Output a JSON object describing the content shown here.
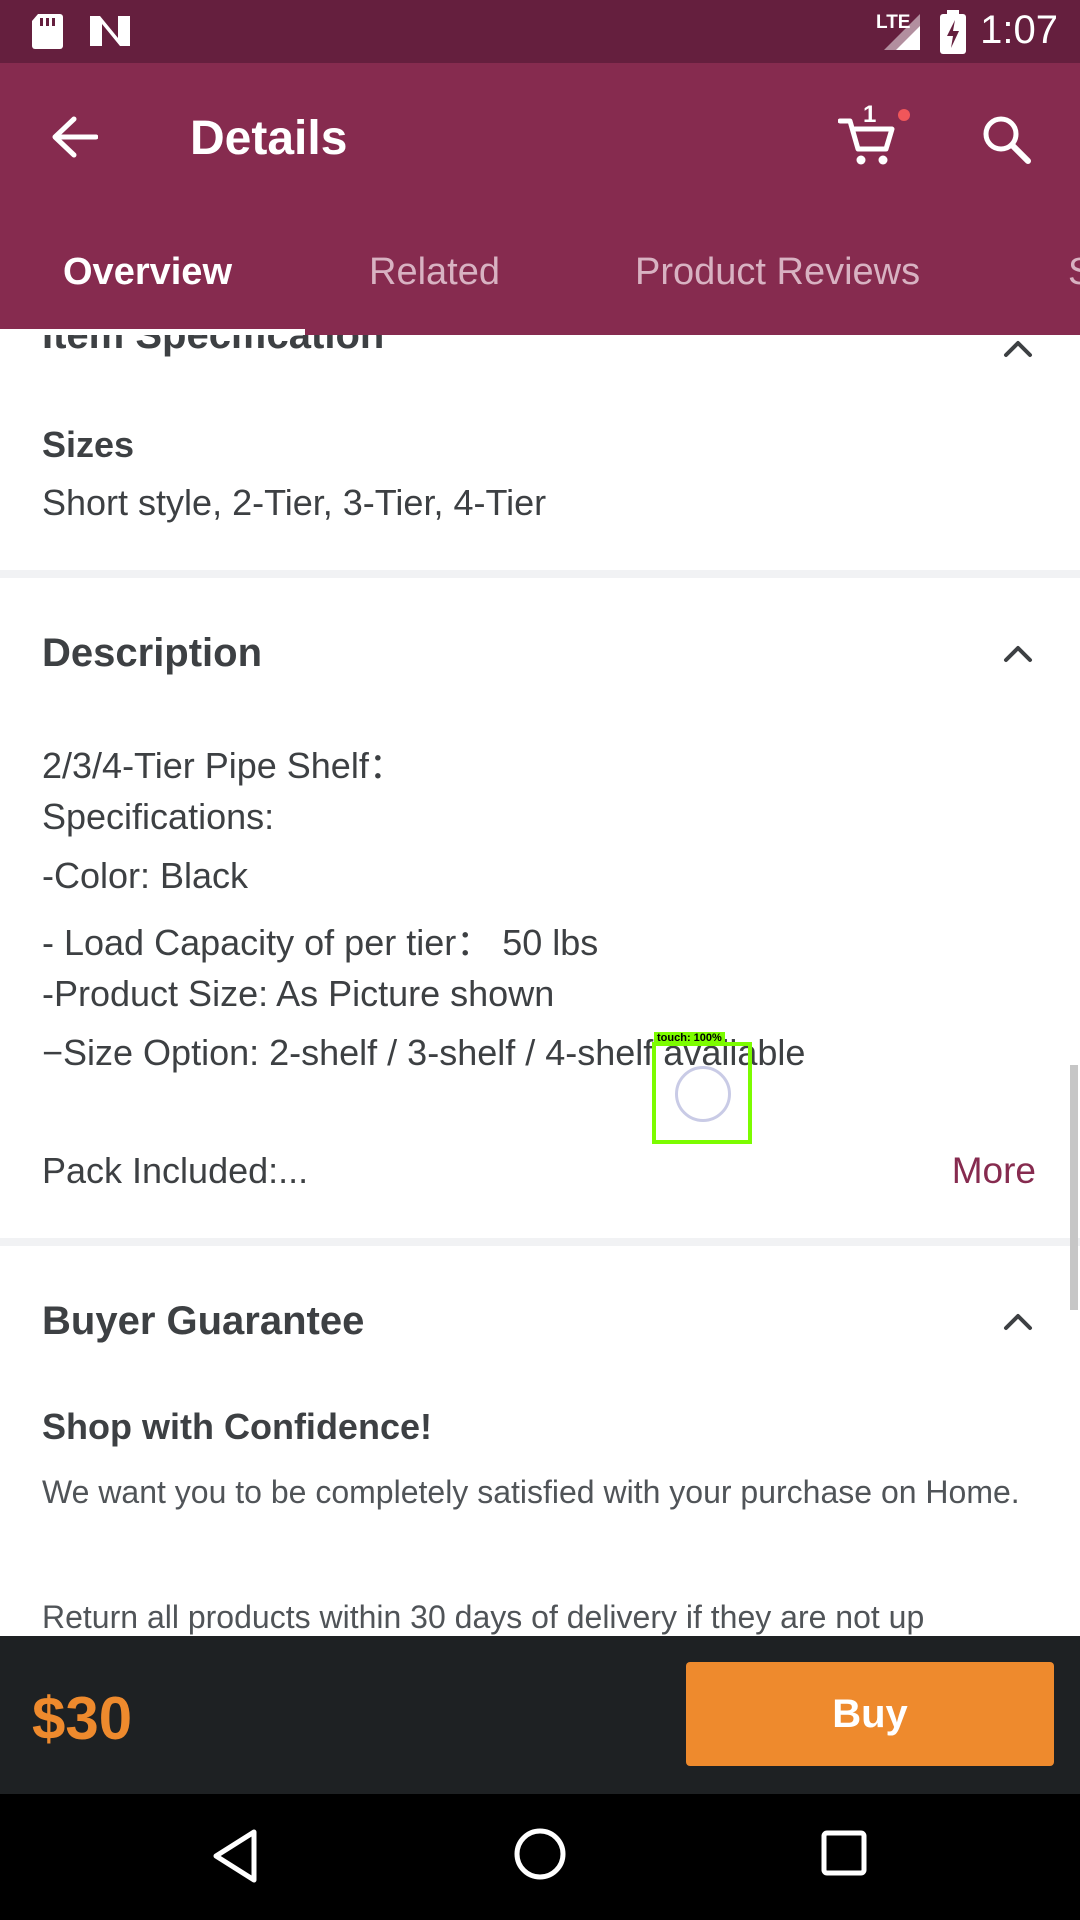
{
  "status_bar": {
    "time": "1:07",
    "network": "LTE"
  },
  "app_bar": {
    "title": "Details",
    "cart_count": "1"
  },
  "tabs": [
    {
      "label": "Overview",
      "active": true
    },
    {
      "label": "Related",
      "active": false
    },
    {
      "label": "Product Reviews",
      "active": false
    },
    {
      "label": "S",
      "active": false
    }
  ],
  "item_spec": {
    "heading": "Item Specification",
    "sizes_label": "Sizes",
    "sizes_value": "Short style, 2-Tier, 3-Tier, 4-Tier"
  },
  "description": {
    "heading": "Description",
    "lines": [
      "2/3/4-Tier Pipe Shelf：",
      "Specifications:",
      "-Color: Black",
      "- Load Capacity of per tier： 50 lbs",
      "-Product Size: As Picture shown",
      "−Size Option: 2-shelf / 3-shelf / 4-shelf  available"
    ],
    "pack_line": "Pack Included:...",
    "more_label": "More"
  },
  "guarantee": {
    "heading": "Buyer Guarantee",
    "subheading": "Shop with Confidence!",
    "para1": "We want you to be completely satisfied with your purchase on Home.",
    "para2": "Return all products within 30 days of delivery if they are not up"
  },
  "touch_overlay": {
    "label": "touch: 100%"
  },
  "purchase": {
    "price": "$30",
    "buy_label": "Buy"
  },
  "colors": {
    "primary": "#862b4f",
    "status_bar": "#651f3e",
    "accent": "#ee8a2d",
    "buy_bar": "#1e2123"
  }
}
